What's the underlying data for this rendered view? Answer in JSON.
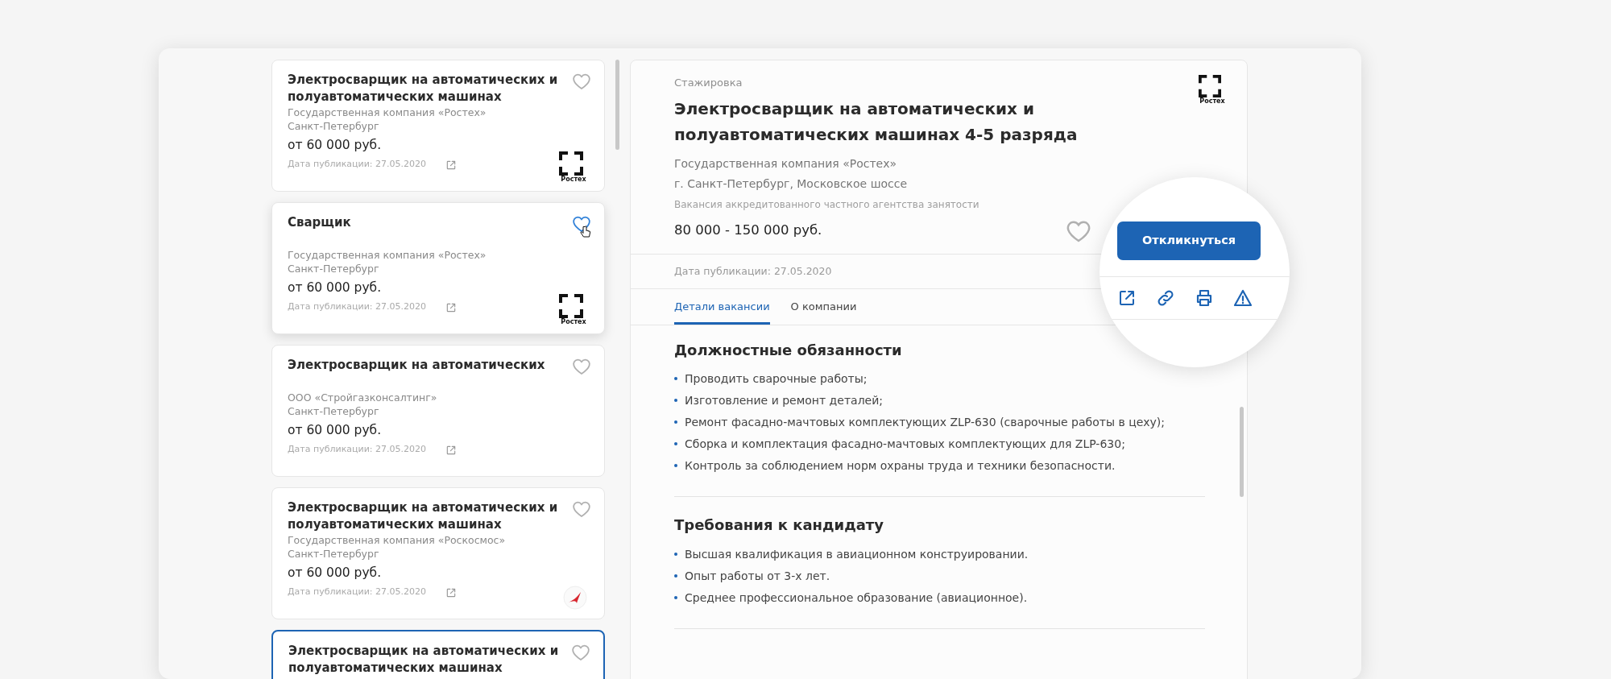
{
  "vacancy_list": [
    {
      "title": "Электросварщик на автоматических и полуавтоматических машинах",
      "company": "Государственная компания «Ростех»",
      "city": "Санкт-Петербург",
      "salary": "от 60 000 руб.",
      "published": "Дата публикации: 27.05.2020",
      "logo": {
        "kind": "rostec",
        "caption": "Ростех"
      },
      "hovered": false,
      "selected": false
    },
    {
      "title": "Сварщик",
      "company": "Государственная компания «Ростех»",
      "city": "Санкт-Петербург",
      "salary": "от 60 000 руб.",
      "published": "Дата публикации: 27.05.2020",
      "logo": {
        "kind": "rostec",
        "caption": "Ростех"
      },
      "hovered": true,
      "selected": false
    },
    {
      "title": "Электросварщик на автоматических",
      "company": "ООО «Стройгазконсалтинг»",
      "city": "Санкт-Петербург",
      "salary": "от 60 000 руб.",
      "published": "Дата публикации: 27.05.2020",
      "hovered": false,
      "selected": false
    },
    {
      "title": "Электросварщик на автоматических и полуавтоматических машинах",
      "company": "Государственная компания «Роскосмос»",
      "city": "Санкт-Петербург",
      "salary": "от 60 000 руб.",
      "published": "Дата публикации: 27.05.2020",
      "logo": {
        "kind": "roscosmos"
      },
      "hovered": false,
      "selected": false
    },
    {
      "title": "Электросварщик на автоматических и полуавтоматических машинах",
      "hovered": false,
      "selected": true
    }
  ],
  "vacancy_detail": {
    "category": "Стажировка",
    "title": "Электросварщик на автоматических и полуавтоматических машинах 4-5 разряда",
    "company": "Государственная компания «Ростех»",
    "address": "г. Санкт-Петербург, Московское шоссе",
    "agency_note": "Вакансия аккредитованного частного агентства занятости",
    "salary": "80 000 - 150 000 руб.",
    "published": "Дата публикации: 27.05.2020",
    "logo": {
      "kind": "rostec",
      "caption": "Ростех"
    },
    "apply_button": "Откликнуться",
    "tabs": [
      {
        "label": "Детали вакансии",
        "selected": true
      },
      {
        "label": "О компании",
        "selected": false
      }
    ],
    "sections": [
      {
        "heading": "Должностные обязанности",
        "items": [
          "Проводить сварочные работы;",
          "Изготовление и ремонт деталей;",
          "Ремонт фасадно-мачтовых комплектующих ZLP-630 (сварочные работы в цеху);",
          "Сборка и комплектация фасадно-мачтовых комплектующих для ZLP-630;",
          "Контроль за соблюдением норм охраны труда и техники безопасности."
        ]
      },
      {
        "heading": "Требования к кандидату",
        "items": [
          "Высшая квалификация в авиационном конструировании.",
          "Опыт работы от 3-х лет.",
          "Среднее профессиональное образование (авиационное)."
        ]
      }
    ]
  }
}
